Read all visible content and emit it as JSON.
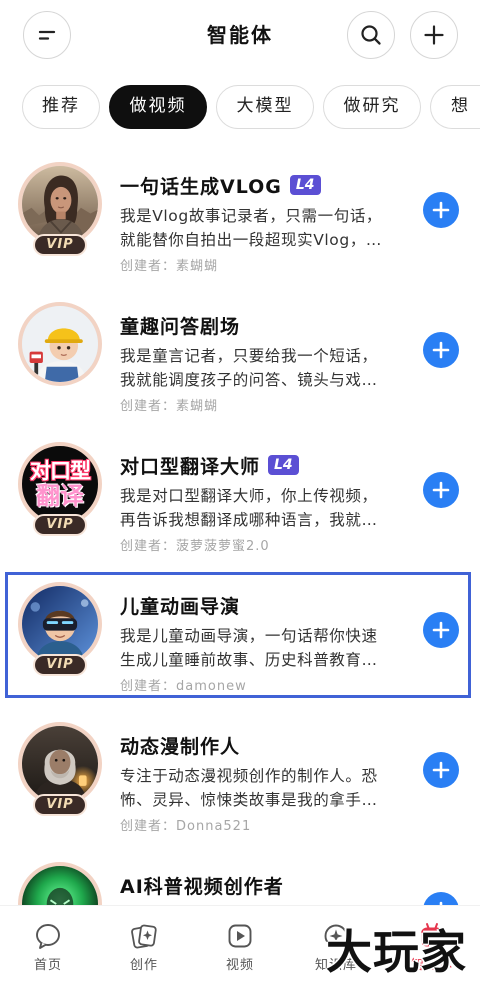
{
  "header": {
    "title": "智能体",
    "menu_icon": "menu-icon",
    "search_icon": "search-icon",
    "add_icon": "plus-icon"
  },
  "tabs": [
    {
      "label": "推荐",
      "selected": false
    },
    {
      "label": "做视频",
      "selected": true
    },
    {
      "label": "大模型",
      "selected": false
    },
    {
      "label": "做研究",
      "selected": false
    },
    {
      "label": "想",
      "selected": false
    }
  ],
  "agents": [
    {
      "name": "一句话生成VLOG",
      "level": "L4",
      "badge": "VIP",
      "description_lines": [
        "我是Vlog故事记录者，只需一句话，",
        "就能替你自拍出一段超现实Vlog，…"
      ],
      "creator": "创建者：素蝴蝴",
      "add_icon": "plus-icon"
    },
    {
      "name": "童趣问答剧场",
      "description_lines": [
        "我是童言记者，只要给我一个短话，",
        "我就能调度孩子的问答、镜头与戏…"
      ],
      "creator": "创建者：素蝴蝴",
      "add_icon": "plus-icon"
    },
    {
      "name": "对口型翻译大师",
      "level": "L4",
      "badge": "VIP",
      "avatar_text": [
        "对口型",
        "翻译"
      ],
      "description_lines": [
        "我是对口型翻译大师，你上传视频，",
        "再告诉我想翻译成哪种语言，我就…"
      ],
      "creator": "创建者：菠萝菠萝蜜2.0",
      "add_icon": "plus-icon"
    },
    {
      "name": "儿童动画导演",
      "badge": "VIP",
      "description_lines": [
        "我是儿童动画导演，一句话帮你快速",
        "生成儿童睡前故事、历史科普教育…"
      ],
      "creator": "创建者：damonew",
      "add_icon": "plus-icon"
    },
    {
      "name": "动态漫制作人",
      "badge": "VIP",
      "description_lines": [
        "专注于动态漫视频创作的制作人。恐",
        "怖、灵异、惊悚类故事是我的拿手…"
      ],
      "creator": "创建者：Donna521",
      "add_icon": "plus-icon"
    },
    {
      "name": "AI科普视频创作者",
      "add_icon": "plus-icon"
    }
  ],
  "bottom_nav": [
    {
      "label": "首页",
      "icon": "chat-bubble-icon"
    },
    {
      "label": "创作",
      "icon": "create-card-icon"
    },
    {
      "label": "视频",
      "icon": "video-play-icon"
    },
    {
      "label": "知识库",
      "icon": "sparkle-icon"
    },
    {
      "label": "智能体",
      "icon": "robot-icon",
      "active": true
    }
  ],
  "watermark": "大玩家",
  "colors": {
    "accent_blue": "#2a7ff4",
    "tab_selected_bg": "#0f0f0f",
    "level_badge": "#5b4fd4",
    "vip_badge_bg": "#3a2a26",
    "vip_text": "#f2dbb4",
    "avatar_ring": "#f2d3c4",
    "highlight_border": "#4062d6",
    "creator_text": "#a6a6a6",
    "nav_active": "#e6374e"
  }
}
